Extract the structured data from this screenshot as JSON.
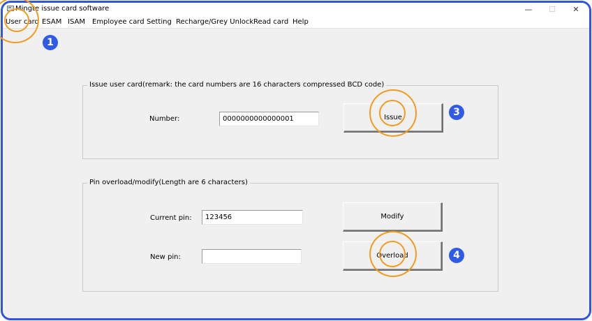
{
  "window": {
    "title": "Mingte issue card software",
    "icon": "app-icon",
    "controls": {
      "minimize": "—",
      "maximize": "☐",
      "close": "✕"
    }
  },
  "menu": [
    {
      "label": "User card"
    },
    {
      "label": "ESAM"
    },
    {
      "label": "ISAM"
    },
    {
      "label": "Employee card"
    },
    {
      "label": "Setting"
    },
    {
      "label": "Recharge/Grey Unlock"
    },
    {
      "label": "Read card"
    },
    {
      "label": "Help"
    }
  ],
  "issue_group": {
    "legend": "Issue user card(remark: the card numbers are 16 characters compressed BCD code)",
    "number_label": "Number:",
    "number_value": "0000000000000001",
    "issue_button": "Issue"
  },
  "pin_group": {
    "legend": "Pin overload/modify(Length are 6 characters)",
    "current_pin_label": "Current pin:",
    "current_pin_value": "123456",
    "new_pin_label": "New pin:",
    "new_pin_value": "",
    "modify_button": "Modify",
    "overload_button": "Overload"
  },
  "annotations": {
    "step_1": "1",
    "step_3": "3",
    "step_4": "4",
    "highlight_color": "#f29b1e",
    "badge_color": "#2f5be6",
    "frame_color": "#2e54e0"
  }
}
